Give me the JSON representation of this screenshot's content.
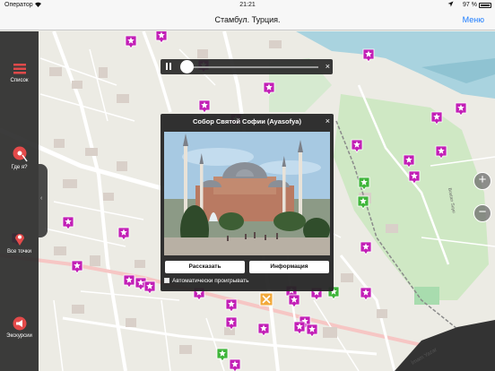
{
  "status": {
    "carrier": "Оператор",
    "time": "21:21",
    "battery": "97 %"
  },
  "nav": {
    "title": "Стамбул. Турция.",
    "menu_label": "Меню"
  },
  "left_panel": {
    "items": [
      {
        "label": "Список",
        "icon": "list-icon"
      },
      {
        "label": "Где я?",
        "icon": "location-pin-icon"
      },
      {
        "label": "Все точки",
        "icon": "map-pin-icon"
      },
      {
        "label": "Экскурсии",
        "icon": "megaphone-icon"
      }
    ],
    "collapse_icon": "chevron-left-icon"
  },
  "zoom": {
    "in": "+",
    "out": "−"
  },
  "audio": {
    "close": "×",
    "progress": 0
  },
  "popup": {
    "title": "Собор Святой Софии (Ayasofya)",
    "close": "×",
    "tell_button": "Рассказать",
    "info_button": "Информация",
    "autoplay_label": "Автоматически проигрывать"
  },
  "map_labels": {
    "road_text": "İmam Yazar",
    "road_text_2": "Bostan Suyu"
  },
  "colors": {
    "poi": "#c21fb6",
    "poi_green": "#3fb53a",
    "accent": "#1a7bff",
    "water": "#a9d3df",
    "park": "#cfe8c4"
  }
}
